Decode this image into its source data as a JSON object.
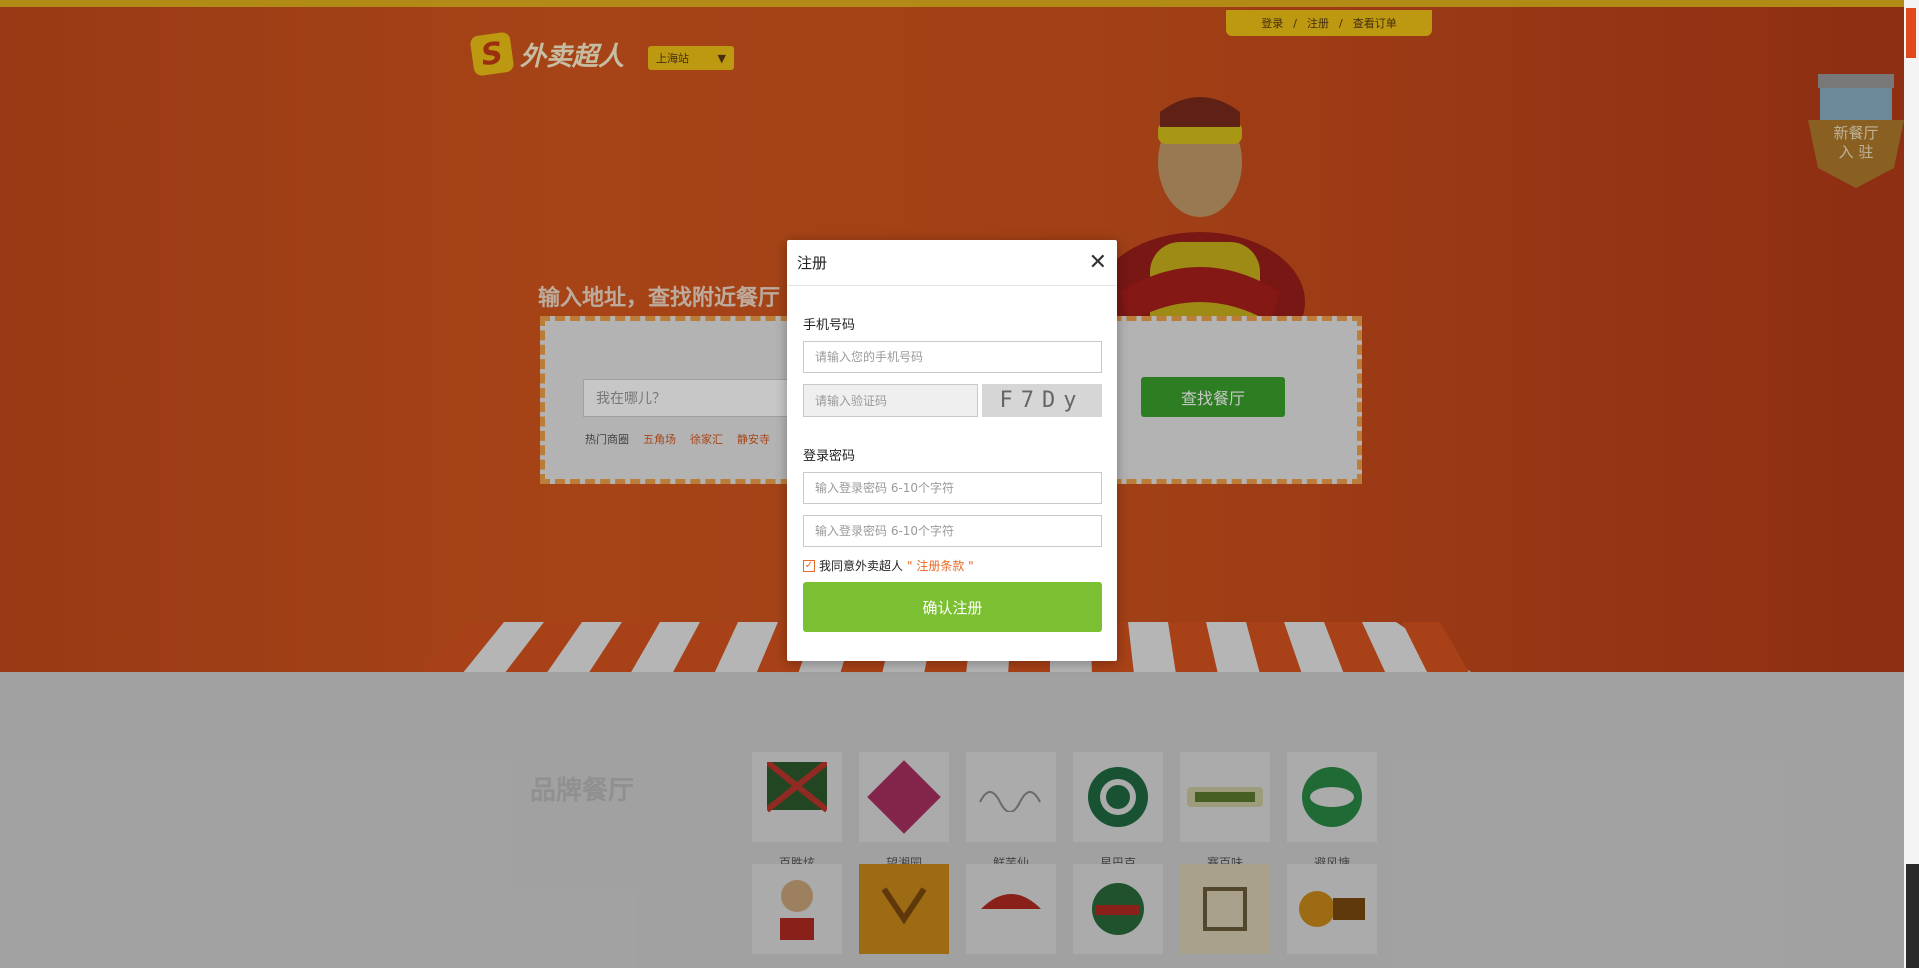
{
  "site": {
    "top_links": [
      "登录",
      "/",
      "注册",
      "/",
      "查看订单"
    ],
    "logo_text": "外卖超人",
    "city": "上海站",
    "tagline": "输入地址，查找附近餐厅",
    "search_placeholder": "我在哪儿？",
    "hot_label": "热门商圈",
    "hot_areas": [
      "五角场",
      "徐家汇",
      "静安寺"
    ],
    "find_button": "查找餐厅",
    "brand_section": "品牌餐厅",
    "new_shop": [
      "新餐厅",
      "入 驻"
    ],
    "brands_row1": [
      "百胜炫",
      "望湘园",
      "鲜芋仙",
      "星巴克",
      "赛百味",
      "避风塘"
    ]
  },
  "modal": {
    "title": "注册",
    "phone_label": "手机号码",
    "phone_placeholder": "请输入您的手机号码",
    "captcha_placeholder": "请输入验证码",
    "captcha_text": "F7Dy",
    "password_label": "登录密码",
    "password_placeholder": "输入登录密码 6-10个字符",
    "password_confirm_placeholder": "输入登录密码 6-10个字符",
    "agree_text": "我同意外卖超人",
    "terms_text": "\" 注册条款 \"",
    "agree_checked": true,
    "submit_label": "确认注册"
  },
  "colors": {
    "primary_green": "#7bbf32",
    "accent_orange": "#e86a25",
    "hero_orange": "#d5581e",
    "yellow": "#f3c317"
  }
}
